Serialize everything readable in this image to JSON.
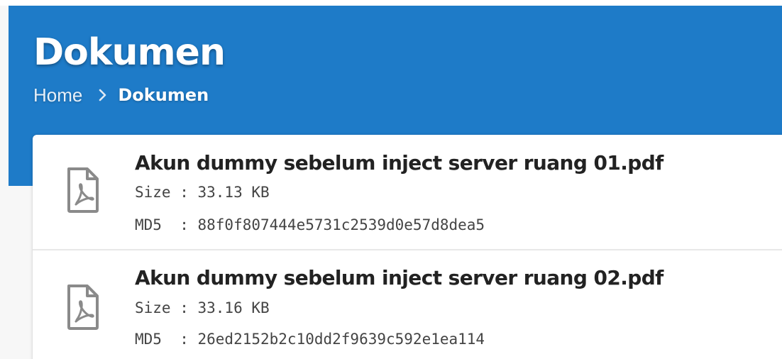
{
  "header": {
    "title": "Dokumen",
    "background_color": "#1e7bc8"
  },
  "breadcrumb": {
    "home_label": "Home",
    "separator_icon": "chevron-right-icon",
    "current_label": "Dokumen"
  },
  "documents": [
    {
      "icon": "pdf-file-icon",
      "name": "Akun dummy sebelum inject server ruang 01.pdf",
      "size_line": "Size : 33.13 KB",
      "md5_line": "MD5  : 88f0f807444e5731c2539d0e57d8dea5"
    },
    {
      "icon": "pdf-file-icon",
      "name": "Akun dummy sebelum inject server ruang 02.pdf",
      "size_line": "Size : 33.16 KB",
      "md5_line": "MD5  : 26ed2152b2c10dd2f9639c592e1ea114"
    }
  ]
}
